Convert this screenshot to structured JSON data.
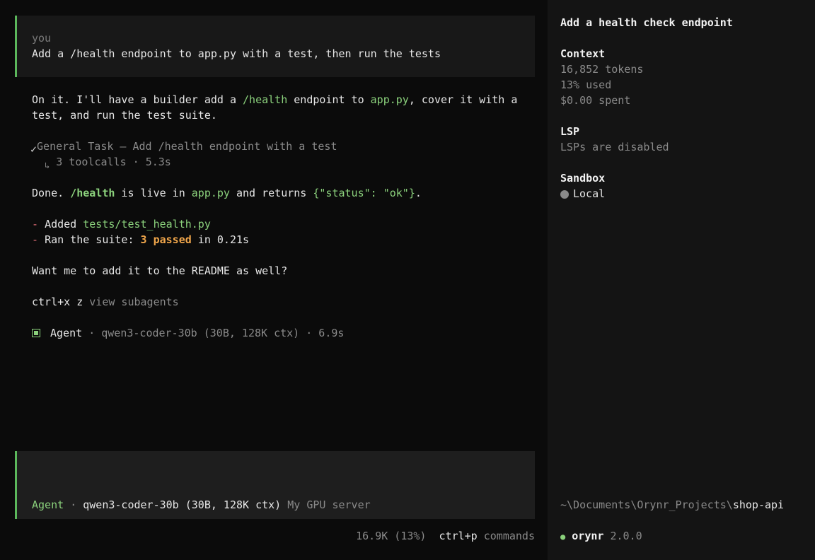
{
  "user_message": {
    "label": "you",
    "text": "Add a /health endpoint to app.py with a test, then run the tests"
  },
  "reply": {
    "intro_1_a": "On it. I'll have a builder add a ",
    "intro_1_b": "/health",
    "intro_1_c": " endpoint to ",
    "intro_1_d": "app.py",
    "intro_1_e": ", cover it with a",
    "intro_2": "test, and run the test suite.",
    "task_check": "✓",
    "task_title": "General Task — Add /health endpoint with a test",
    "task_sub_arrow": "↳",
    "task_sub": "3 toolcalls · 5.3s",
    "done_a": "Done. ",
    "done_b": "/health",
    "done_c": " is live in ",
    "done_d": "app.py",
    "done_e": " and returns ",
    "done_f": "{\"status\": \"ok\"}",
    "done_g": ".",
    "bullet_1_dash": "-",
    "bullet_1_a": "Added ",
    "bullet_1_b": "tests/test_health.py",
    "bullet_2_dash": "-",
    "bullet_2_a": "Ran the suite: ",
    "bullet_2_b": "3 passed",
    "bullet_2_c": " in 0.21s",
    "question": "Want me to add it to the README as well?",
    "shortcut_key": "ctrl+x z",
    "shortcut_label": "view subagents",
    "agent_name": "Agent",
    "agent_meta": "· qwen3-coder-30b (30B, 128K ctx) · 6.9s"
  },
  "input": {
    "mode": "Agent",
    "sep": "·",
    "model": "qwen3-coder-30b (30B, 128K ctx)",
    "server": "My GPU server"
  },
  "footer": {
    "usage": "16.9K (13%)",
    "cmd_key": "ctrl+p",
    "cmd_label": "commands"
  },
  "sidebar": {
    "title": "Add a health check endpoint",
    "context_heading": "Context",
    "tokens": "16,852 tokens",
    "used": "13% used",
    "spent": "$0.00 spent",
    "lsp_heading": "LSP",
    "lsp_status": "LSPs are disabled",
    "sandbox_heading": "Sandbox",
    "sandbox_value": "Local",
    "path_prefix": "~\\Documents\\Orynr_Projects\\",
    "path_project": "shop-api",
    "app_name": "orynr",
    "app_version": "2.0.0"
  },
  "colors": {
    "accent": "#5cb85c",
    "code": "#8bd17c",
    "highlight": "#f0a64b",
    "bullet": "#e06c75"
  }
}
